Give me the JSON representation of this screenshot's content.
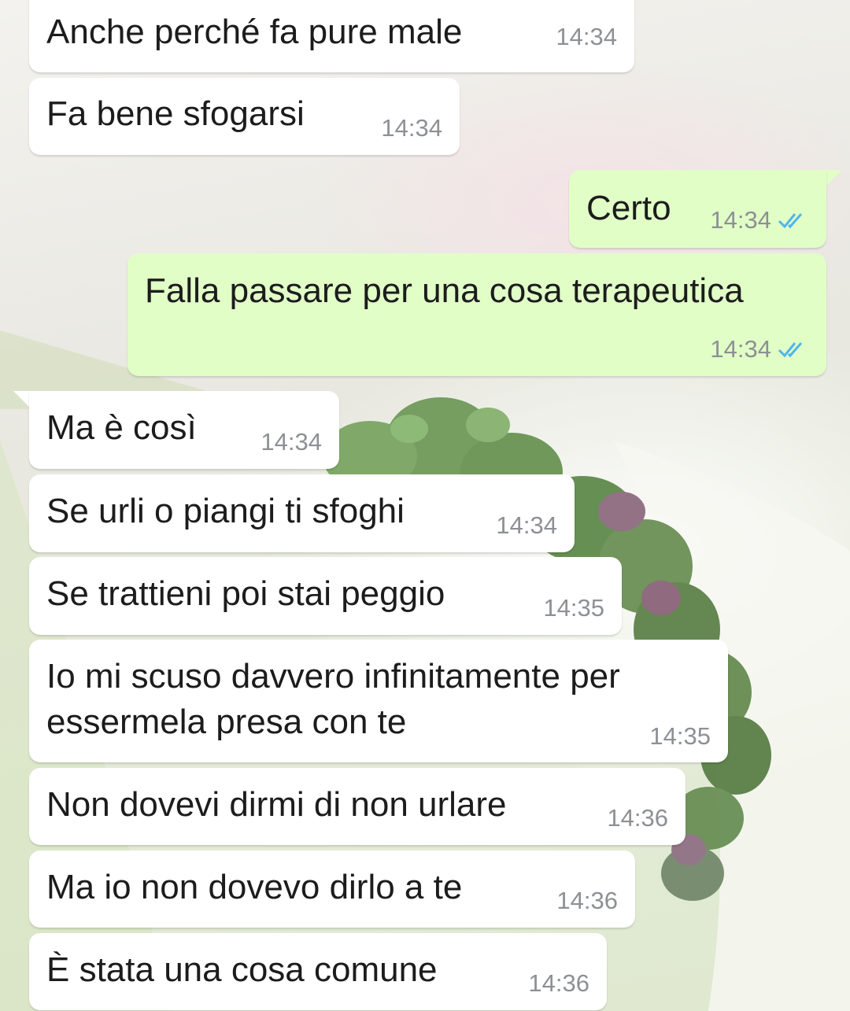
{
  "colors": {
    "incoming_bubble": "#ffffff",
    "outgoing_bubble": "#e1fec7",
    "timestamp": "#8d9095",
    "read_ticks": "#4fb6ec"
  },
  "messages": [
    {
      "direction": "in",
      "text": "Anche perché fa pure male",
      "time": "14:34"
    },
    {
      "direction": "in",
      "text": "Fa bene sfogarsi",
      "time": "14:34"
    },
    {
      "direction": "out",
      "text": "Certo",
      "time": "14:34",
      "status": "read-double-tick-icon"
    },
    {
      "direction": "out",
      "text": "Falla passare per una cosa terapeutica",
      "time": "14:34",
      "status": "read-double-tick-icon"
    },
    {
      "direction": "in",
      "text": "Ma è così",
      "time": "14:34"
    },
    {
      "direction": "in",
      "text": "Se urli o piangi ti sfoghi",
      "time": "14:34"
    },
    {
      "direction": "in",
      "text": "Se trattieni poi stai peggio",
      "time": "14:35"
    },
    {
      "direction": "in",
      "text_lines": [
        "Io mi scuso davvero infinitamente per",
        "essermela presa con te"
      ],
      "time": "14:35"
    },
    {
      "direction": "in",
      "text": "Non dovevi dirmi di non urlare",
      "time": "14:36"
    },
    {
      "direction": "in",
      "text": "Ma io non dovevo dirlo a te",
      "time": "14:36"
    },
    {
      "direction": "in",
      "text": "È stata una cosa comune",
      "time": "14:36"
    }
  ]
}
